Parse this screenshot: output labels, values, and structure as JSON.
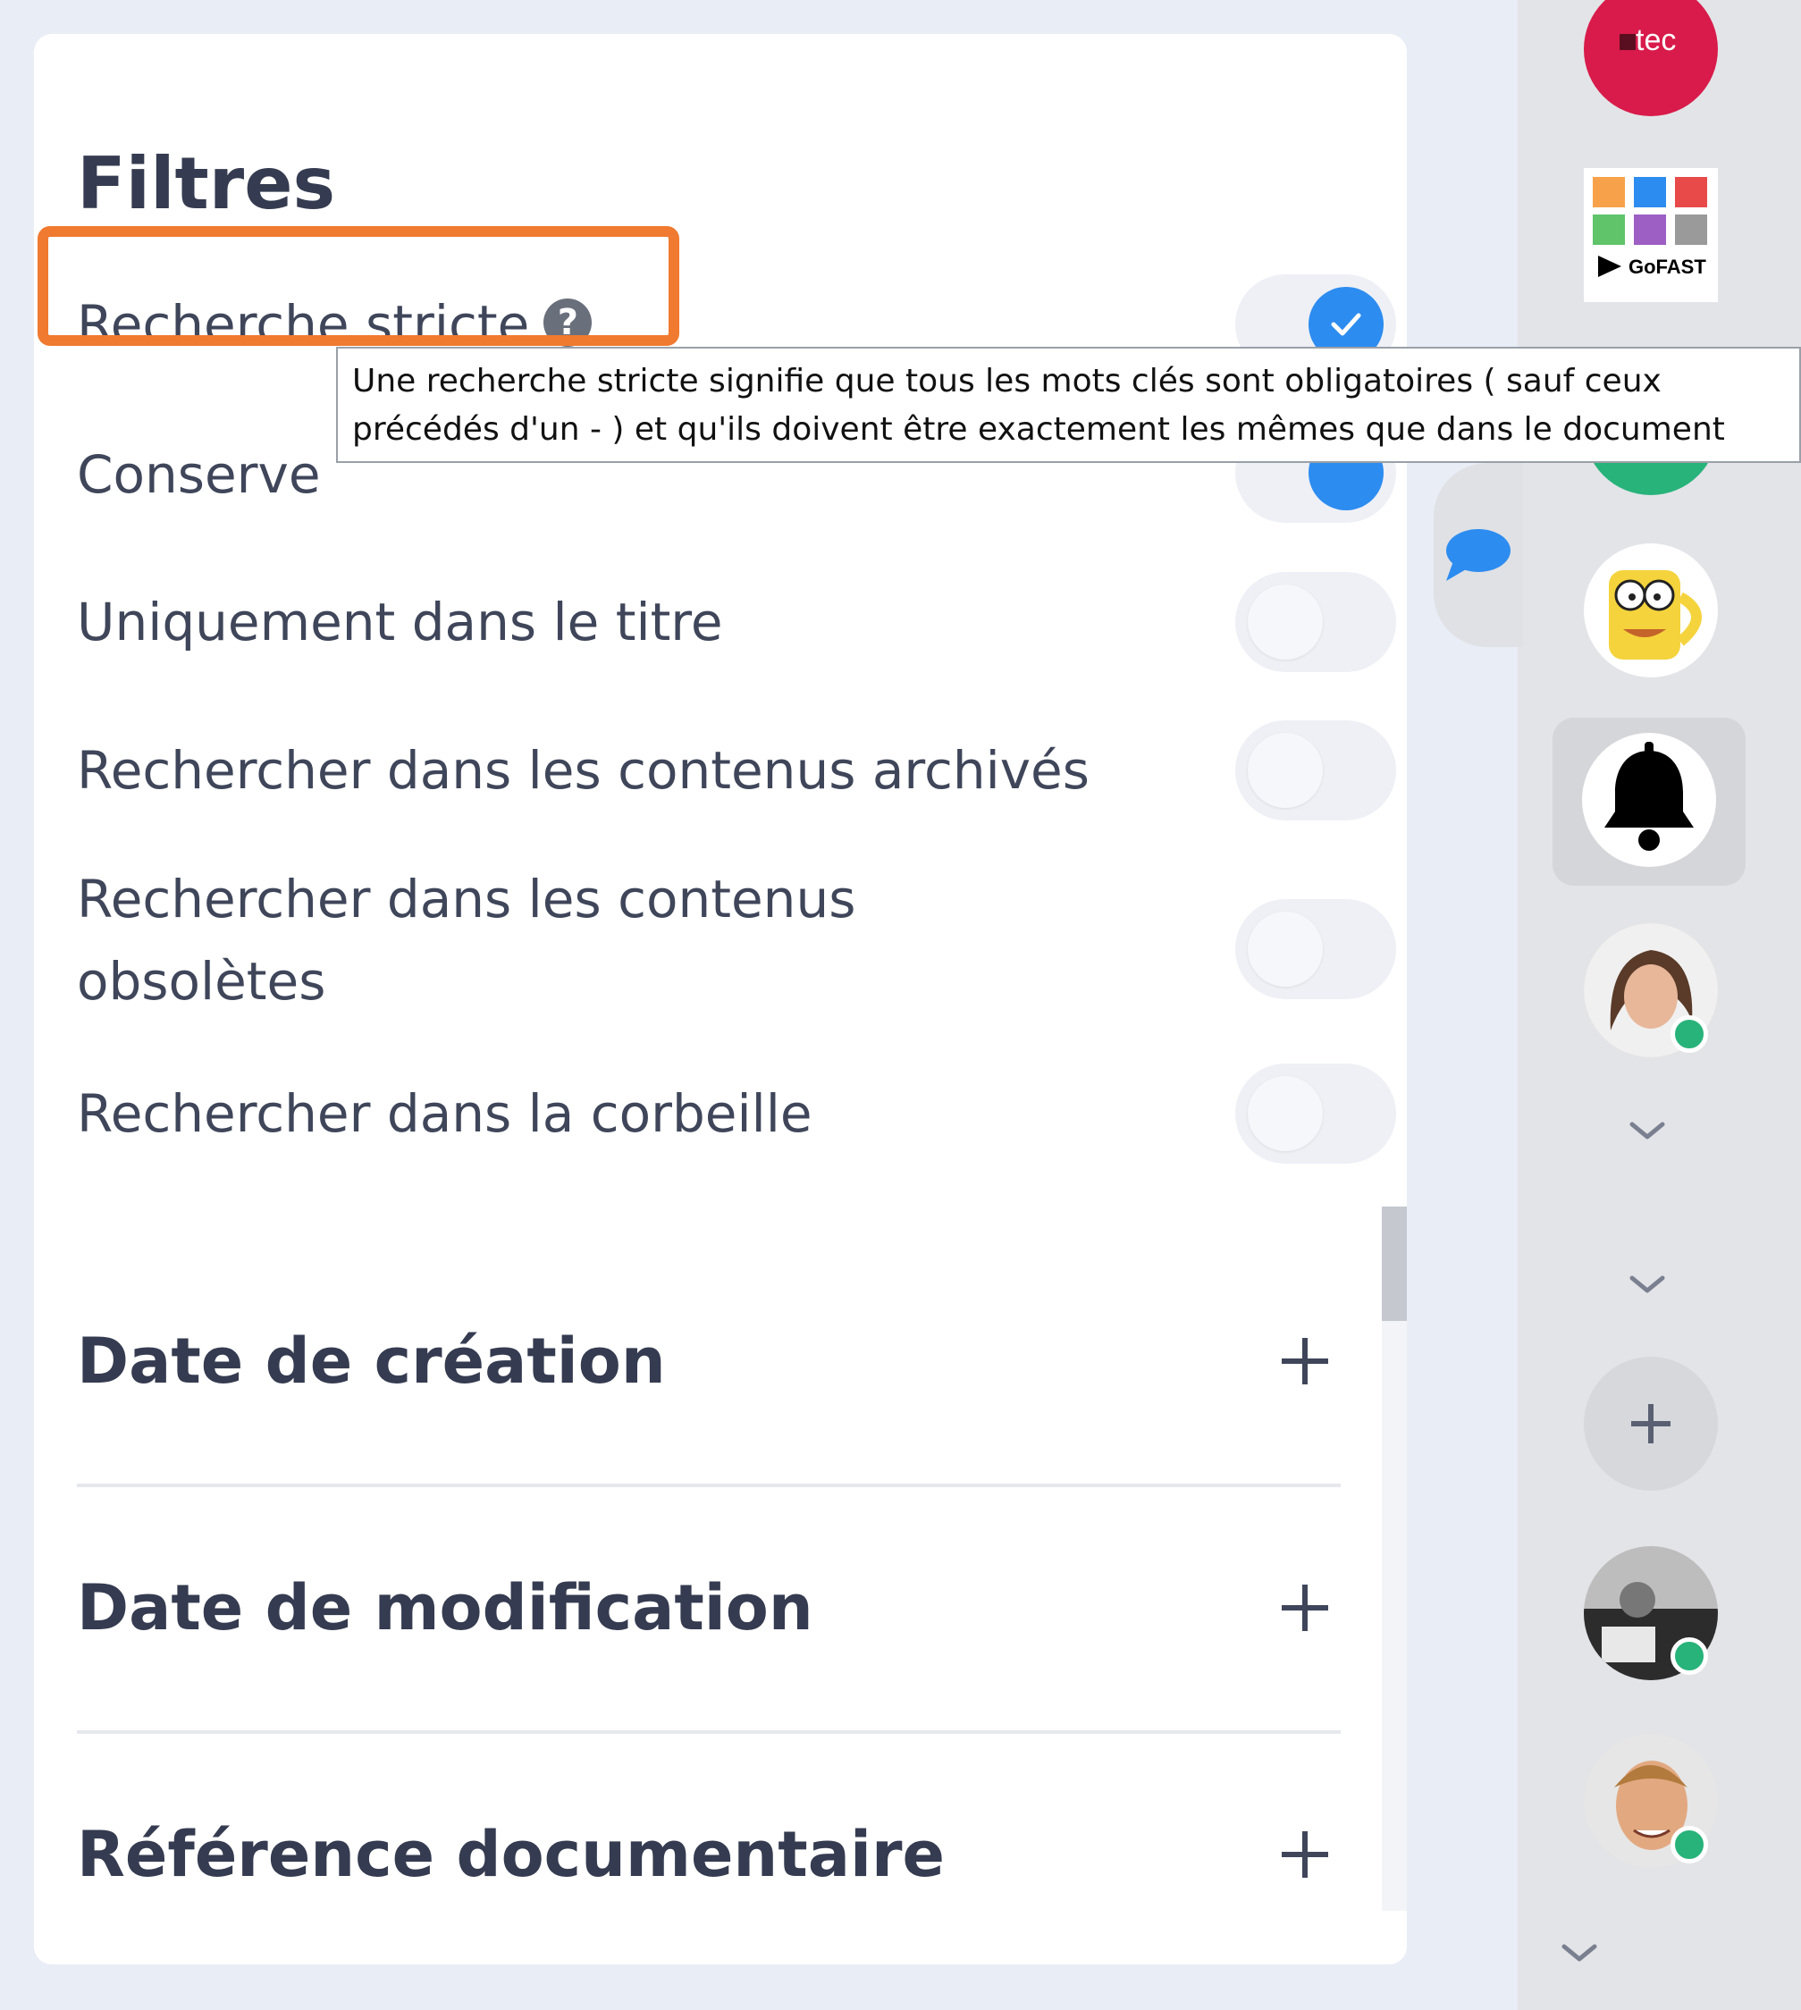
{
  "panel": {
    "title": "Filtres",
    "filters": [
      {
        "label": "Recherche stricte",
        "enabled": true,
        "has_help": true
      },
      {
        "label": "Conserve",
        "enabled": true,
        "has_help": false
      },
      {
        "label": "Uniquement dans le titre",
        "enabled": false,
        "has_help": false
      },
      {
        "label": "Rechercher dans les contenus archivés",
        "enabled": false,
        "has_help": false
      },
      {
        "label": "Rechercher dans les contenus obsolètes",
        "enabled": false,
        "has_help": false
      },
      {
        "label": "Rechercher dans la corbeille",
        "enabled": false,
        "has_help": false
      }
    ],
    "sections": [
      {
        "title": "Date de création",
        "action_symbol": "+"
      },
      {
        "title": "Date de modification",
        "action_symbol": "+"
      },
      {
        "title": "Référence documentaire",
        "action_symbol": "+"
      }
    ]
  },
  "tooltip": {
    "line1": "Une recherche stricte signifie que tous les mots clés sont obligatoires ( sauf ceux",
    "line2": "précédés d'un - ) et qu'ils doivent être exactement les mêmes que dans le document"
  },
  "help_symbol": "?",
  "rail": {
    "logo_text": "tec",
    "gofast_text": "GoFAST",
    "add_symbol": "+"
  },
  "colors": {
    "accent": "#2d8cf0",
    "highlight": "#f07a2f",
    "online": "#27b37a",
    "logo_red": "#d81b4a"
  },
  "icons": [
    "help-icon",
    "check-icon",
    "plus-icon",
    "chat-icon",
    "bell-icon",
    "chevron-down-icon"
  ]
}
